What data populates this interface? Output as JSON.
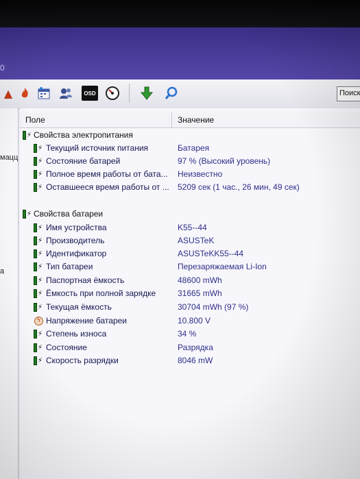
{
  "window": {
    "title_fragment": "0"
  },
  "toolbar": {
    "icons": [
      "fire-icon",
      "calendar-icon",
      "users-icon",
      "osd-icon",
      "gauge-icon",
      "download-arrow-icon",
      "search-icon"
    ],
    "osd_label": "OSD",
    "search_label": "Поиск"
  },
  "leftpane": {
    "text1": "мацц",
    "text2": "а"
  },
  "columns": {
    "field": "Поле",
    "value": "Значение"
  },
  "groups": [
    {
      "title": "Свойства электропитания",
      "rows": [
        {
          "label": "Текущий источник питания",
          "value": "Батарея"
        },
        {
          "label": "Состояние батарей",
          "value": "97 % (Высокий уровень)"
        },
        {
          "label": "Полное время работы от бата...",
          "value": "Неизвестно"
        },
        {
          "label": "Оставшееся время работы от ...",
          "value": "5209 сек (1 час., 26 мин, 49 сек)"
        }
      ]
    },
    {
      "title": "Свойства батареи",
      "rows": [
        {
          "label": "Имя устройства",
          "value": "K55--44"
        },
        {
          "label": "Производитель",
          "value": "ASUSTeK"
        },
        {
          "label": "Идентификатор",
          "value": "ASUSTeKK55--44"
        },
        {
          "label": "Тип батареи",
          "value": "Перезаряжаемая Li-Ion"
        },
        {
          "label": "Паспортная ёмкость",
          "value": "48600 mWh"
        },
        {
          "label": "Ёмкость при полной зарядке",
          "value": "31665 mWh"
        },
        {
          "label": "Текущая ёмкость",
          "value": "30704 mWh  (97 %)"
        },
        {
          "label": "Напряжение батареи",
          "value": "10.800 V"
        },
        {
          "label": "Степень износа",
          "value": "34 %"
        },
        {
          "label": "Состояние",
          "value": "Разрядка"
        },
        {
          "label": "Скорость разрядки",
          "value": "8046 mW"
        }
      ]
    }
  ]
}
